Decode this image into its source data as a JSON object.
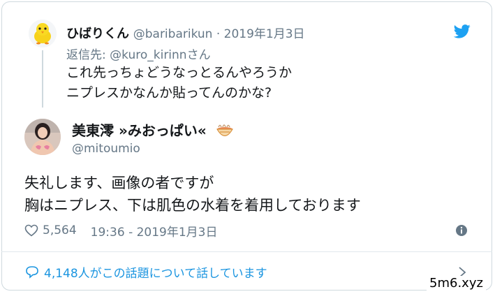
{
  "reply": {
    "name": "ひばりくん",
    "handle_date": "@baribarikun · 2019年1月3日",
    "reply_to_prefix": "返信先: ",
    "reply_to_handle": "@kuro_kirinnさん",
    "text_line1": "これ先っちょどうなっとるんやろうか",
    "text_line2": "ニプレスかなんか貼ってんのかな?"
  },
  "tweet": {
    "name": "美東澪 »みおっぱい«",
    "handle": "@mitoumio",
    "text_line1": "失礼します、画像の者ですが",
    "text_line2": "胸はニプレス、下は肌色の水着を着用しております",
    "likes": "5,564",
    "timestamp": "19:36 - 2019年1月3日"
  },
  "footer": {
    "discussion": "4,148人がこの話題について話しています"
  },
  "watermark": "5m6.xyz",
  "icons": {
    "twitter": "twitter-bird-icon",
    "heart": "heart-icon",
    "info": "info-icon",
    "comment": "comment-icon",
    "chevron": "chevron-right-icon",
    "noodle": "noodle-bowl-emoji-icon"
  },
  "colors": {
    "accent": "#1da1f2",
    "link": "#1b95e0",
    "secondary_text": "#657786",
    "border": "#cfd9de"
  }
}
